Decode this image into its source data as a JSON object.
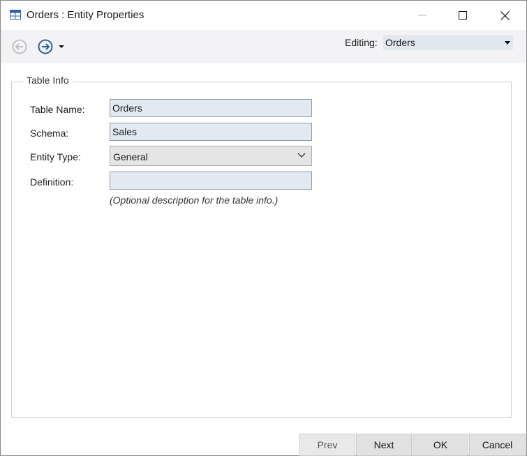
{
  "window": {
    "title": "Orders : Entity Properties"
  },
  "toolbar": {
    "back_icon": "circle-arrow-left-icon",
    "forward_icon": "circle-arrow-right-icon",
    "editing_label": "Editing:",
    "editing_value": "Orders"
  },
  "group": {
    "legend": "Table Info"
  },
  "form": {
    "table_name_label": "Table Name:",
    "table_name_value": "Orders",
    "schema_label": "Schema:",
    "schema_value": "Sales",
    "entity_type_label": "Entity Type:",
    "entity_type_value": "General",
    "definition_label": "Definition:",
    "definition_value": "",
    "definition_hint": "(Optional description for the table info.)"
  },
  "footer": {
    "prev_label": "Prev",
    "next_label": "Next",
    "ok_label": "OK",
    "cancel_label": "Cancel"
  },
  "colors": {
    "accent": "#2b5fa8",
    "input_bg": "#e3e9f1",
    "toolbar_bg": "#f3f3f5"
  }
}
